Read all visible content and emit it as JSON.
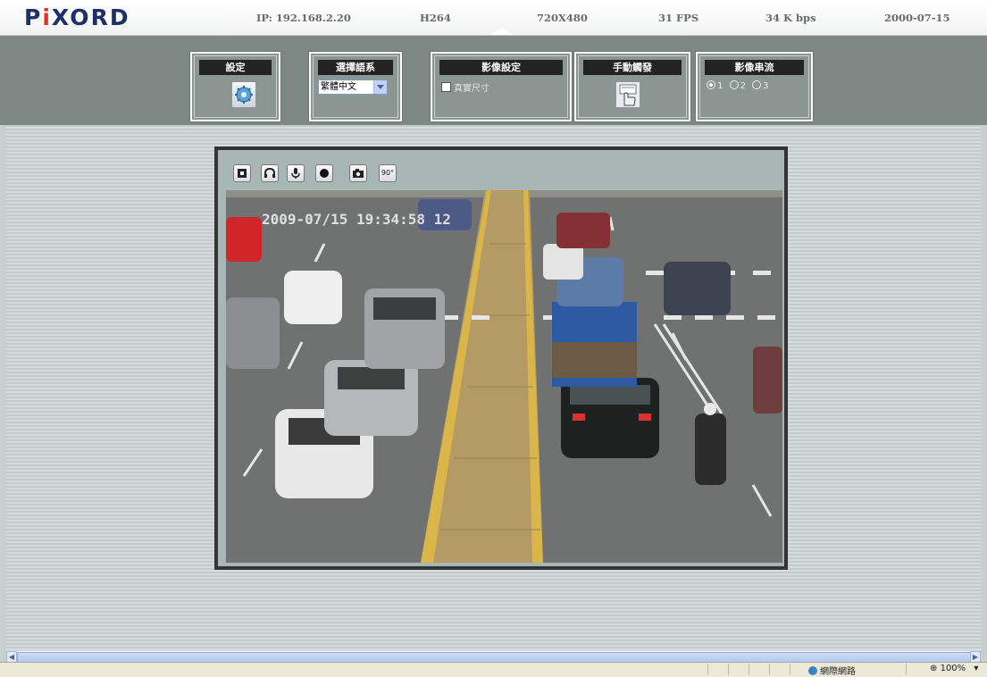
{
  "header": {
    "logo_text": "PiXORD",
    "ip": "IP: 192.168.2.20",
    "codec": "H264",
    "resolution": "720X480",
    "fps": "31  FPS",
    "bitrate": "34  K bps",
    "date": "2000-07-15"
  },
  "panels": {
    "settings": {
      "title": "設定",
      "icon": "gear-icon"
    },
    "language": {
      "title": "選擇語系",
      "selected": "繁體中文"
    },
    "image": {
      "title": "影像設定",
      "checkbox_label": "真實尺寸",
      "checked": false
    },
    "trigger": {
      "title": "手動觸發",
      "icon": "trigger-hand-icon"
    },
    "stream": {
      "title": "影像串流",
      "options": [
        "1",
        "2",
        "3"
      ],
      "selected": "1"
    }
  },
  "viewer": {
    "tools": [
      "fullscreen-icon",
      "headphone-icon",
      "microphone-icon",
      "record-icon",
      "snapshot-icon",
      "rotate-90-icon"
    ],
    "rotate_label": "90°",
    "timestamp_overlay": "2009-07/15 19:34:58 12"
  },
  "statusbar": {
    "zone": "網際網路",
    "zoom": "100%"
  },
  "colors": {
    "logo": "#1d2f68",
    "logo_accent": "#e3322a",
    "band": "#7d8784",
    "panel_title_bg": "#232323"
  }
}
